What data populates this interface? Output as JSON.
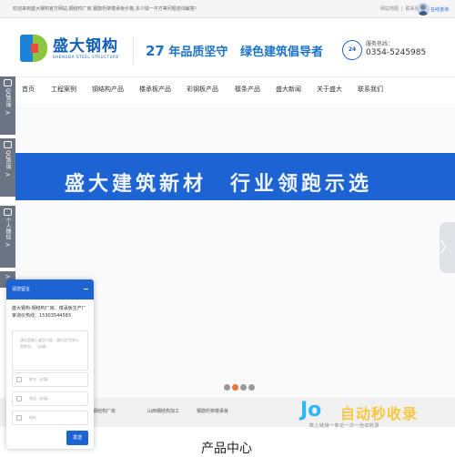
{
  "topbar": {
    "welcome": "欢迎来到盛大钢构官方网站,钢结构厂房,钢筋桁架楼承板价格,多少钱一平方等问题咨询解答！",
    "links": [
      "网站地图",
      "|",
      "联系我们"
    ]
  },
  "kefu": {
    "label": "在线咨询"
  },
  "logo": {
    "name": "盛大钢构",
    "en": "SHENGDA STEEL STRUCTURE"
  },
  "slogan": {
    "num": "27",
    "text1": "年品质坚守",
    "text2": "绿色建筑倡导者"
  },
  "hotline": {
    "icon_text": "24",
    "label": "服务热线：",
    "number": "0354-5245985"
  },
  "nav": [
    "首页",
    "工程案例",
    "钢结构产品",
    "楼承板产品",
    "彩钢板产品",
    "檩条产品",
    "盛大新闻",
    "关于盛大",
    "联系我们"
  ],
  "sidebar": [
    {
      "label": "QQ咨询",
      "arrow": ">"
    },
    {
      "label": "QQ咨询",
      "arrow": ">"
    },
    {
      "label": "个人微信",
      "arrow": ">"
    },
    {
      "label": "",
      "arrow": ">"
    }
  ],
  "banner": {
    "text": "盛大建筑新材　行业领跑示选",
    "next": "〉"
  },
  "slider_dots": {
    "count": 4,
    "active": 1,
    "colors": [
      "#999999",
      "#e8763a",
      "#999999",
      "#999999"
    ]
  },
  "subbar": {
    "links": [
      "钢结构厂房",
      "山西钢结构加工",
      "钢筋桁架楼承板"
    ]
  },
  "section": {
    "title": "产品中心"
  },
  "message": {
    "header": "请您留言",
    "intro": "盛大钢构-钢结构厂房、楼承板生产厂家询价热线：15303544583",
    "textarea_placeholder": "请在此输入留言内容，我们会尽快与您联系。（必填）",
    "name_placeholder": "姓名（必填）",
    "phone_placeholder": "电话（必填）",
    "address_placeholder": "地址",
    "send": "发送"
  },
  "watermark": {
    "logo": "Jo",
    "title": "自动秒收录",
    "sub": "数上链接一条访一次一自动收录"
  }
}
